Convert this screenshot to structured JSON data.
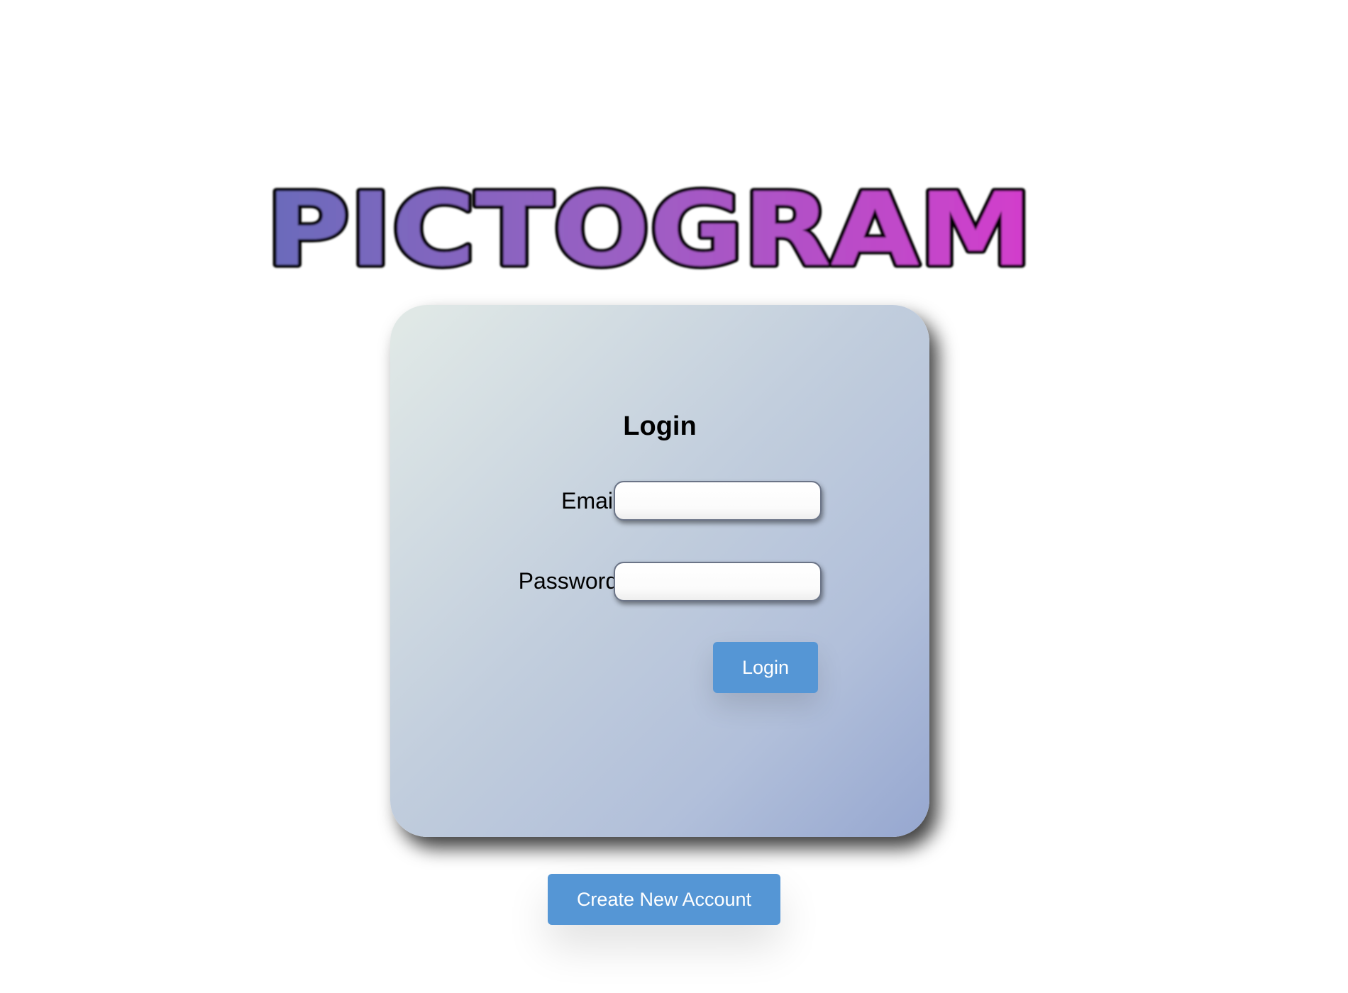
{
  "app": {
    "logo_text": "PICTOGRAM",
    "colors": {
      "logo_gradient_start": "#6a6bbb",
      "logo_gradient_end": "#d33dcc",
      "button_blue": "#5596d5",
      "card_gradient_light": "#e2eae7",
      "card_gradient_dark": "#96a7d0"
    }
  },
  "login_form": {
    "title": "Login",
    "email_label": "Email:",
    "email_value": "",
    "password_label": "Password:",
    "password_value": "",
    "submit_label": "Login"
  },
  "footer": {
    "create_account_label": "Create New Account"
  }
}
